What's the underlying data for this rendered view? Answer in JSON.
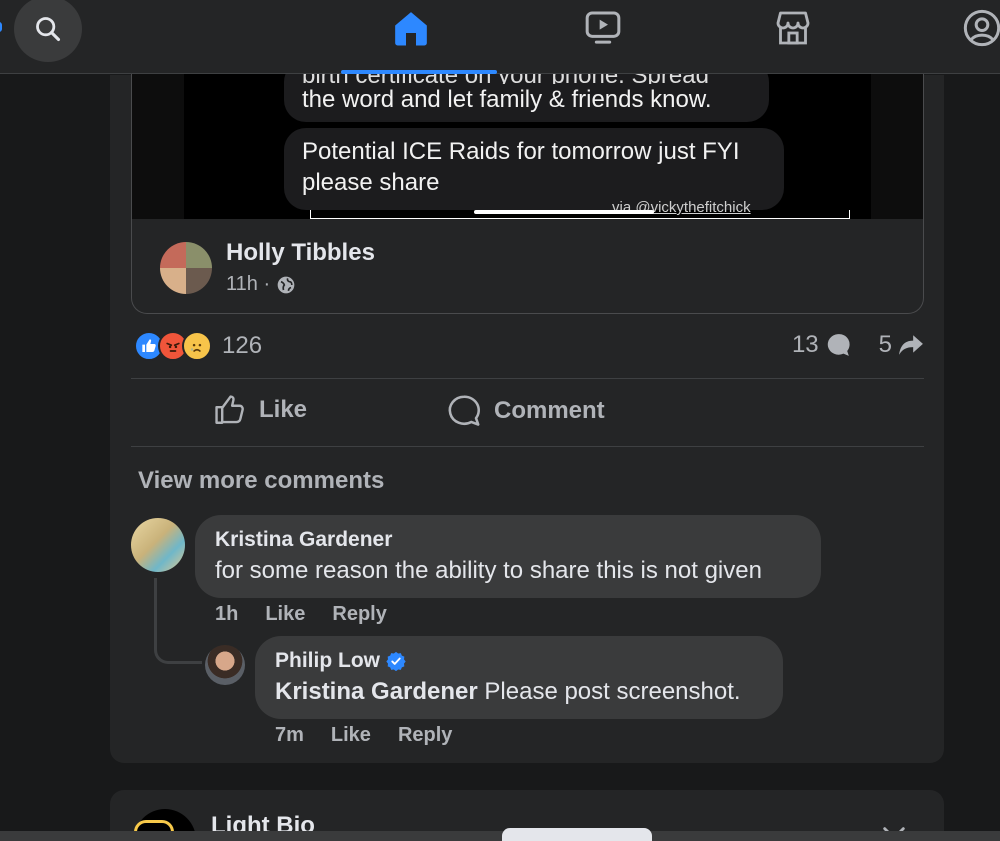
{
  "nav": {
    "items": [
      {
        "name": "search",
        "icon": "search-icon"
      },
      {
        "name": "home",
        "icon": "home-icon",
        "active": true
      },
      {
        "name": "video",
        "icon": "video-icon"
      },
      {
        "name": "marketplace",
        "icon": "marketplace-icon"
      },
      {
        "name": "profile",
        "icon": "profile-icon"
      }
    ],
    "accent": "#2d88ff"
  },
  "shared_post": {
    "media_text_line1_partial": "birth certificate on your phone. Spread",
    "media_text_line2": "the word and let family & friends know.",
    "media_text_2": "Potential ICE Raids for tomorrow just FYI please share",
    "watermark": "via @vickythefitchick",
    "author": "Holly Tibbles",
    "time": "11h ·",
    "audience_icon": "globe-icon"
  },
  "post": {
    "reaction_count": "126",
    "comment_count": "13",
    "share_count": "5",
    "reactions": [
      "like",
      "angry",
      "sad"
    ],
    "like_label": "Like",
    "comment_label": "Comment",
    "view_more": "View more comments"
  },
  "comments": [
    {
      "author": "Kristina Gardener",
      "text": "for some reason the ability to share this is not given",
      "time": "1h",
      "like": "Like",
      "reply": "Reply"
    },
    {
      "author": "Philip Low",
      "verified": true,
      "mention": "Kristina Gardener",
      "text": " Please post screenshot.",
      "time": "7m",
      "like": "Like",
      "reply": "Reply"
    }
  ],
  "next_post": {
    "author": "Light Bio"
  }
}
